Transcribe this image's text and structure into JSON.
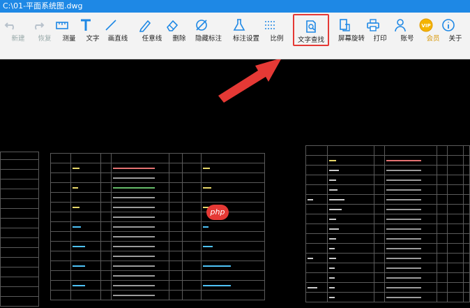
{
  "window": {
    "title": "C:\\01-平面系统图.dwg"
  },
  "toolbar": {
    "tools": [
      {
        "id": "new",
        "label": "新建",
        "icon": "undo-icon",
        "enabled": false
      },
      {
        "id": "redo",
        "label": "恢复",
        "icon": "redo-icon",
        "enabled": false
      },
      {
        "id": "measure",
        "label": "测量",
        "icon": "ruler-icon",
        "enabled": true
      },
      {
        "id": "text",
        "label": "文字",
        "icon": "text-icon",
        "enabled": true
      },
      {
        "id": "line",
        "label": "画直线",
        "icon": "line-icon",
        "enabled": true
      },
      {
        "id": "freeline",
        "label": "任意线",
        "icon": "pencil-icon",
        "enabled": true
      },
      {
        "id": "erase",
        "label": "删除",
        "icon": "eraser-icon",
        "enabled": true
      },
      {
        "id": "hide",
        "label": "隐藏标注",
        "icon": "hide-icon",
        "enabled": true
      },
      {
        "id": "markset",
        "label": "标注设置",
        "icon": "flask-icon",
        "enabled": true
      },
      {
        "id": "scale",
        "label": "比例",
        "icon": "scale-icon",
        "enabled": true
      },
      {
        "id": "findtext",
        "label": "文字查找",
        "icon": "search-doc-icon",
        "enabled": true,
        "highlighted": true
      },
      {
        "id": "rotate",
        "label": "屏幕旋转",
        "icon": "rotate-icon",
        "enabled": true
      },
      {
        "id": "print",
        "label": "打印",
        "icon": "printer-icon",
        "enabled": true
      },
      {
        "id": "account",
        "label": "账号",
        "icon": "user-icon",
        "enabled": true
      },
      {
        "id": "vip",
        "label": "会员",
        "icon": "vip-icon",
        "enabled": true,
        "badge": "VIP"
      },
      {
        "id": "about",
        "label": "关于",
        "icon": "info-icon",
        "enabled": true
      }
    ]
  },
  "canvas": {
    "watermark": "php"
  },
  "colors": {
    "titlebar": "#1e88e5",
    "highlight": "#e53935",
    "arrow": "#e53935",
    "icon": "#1e88e5"
  }
}
